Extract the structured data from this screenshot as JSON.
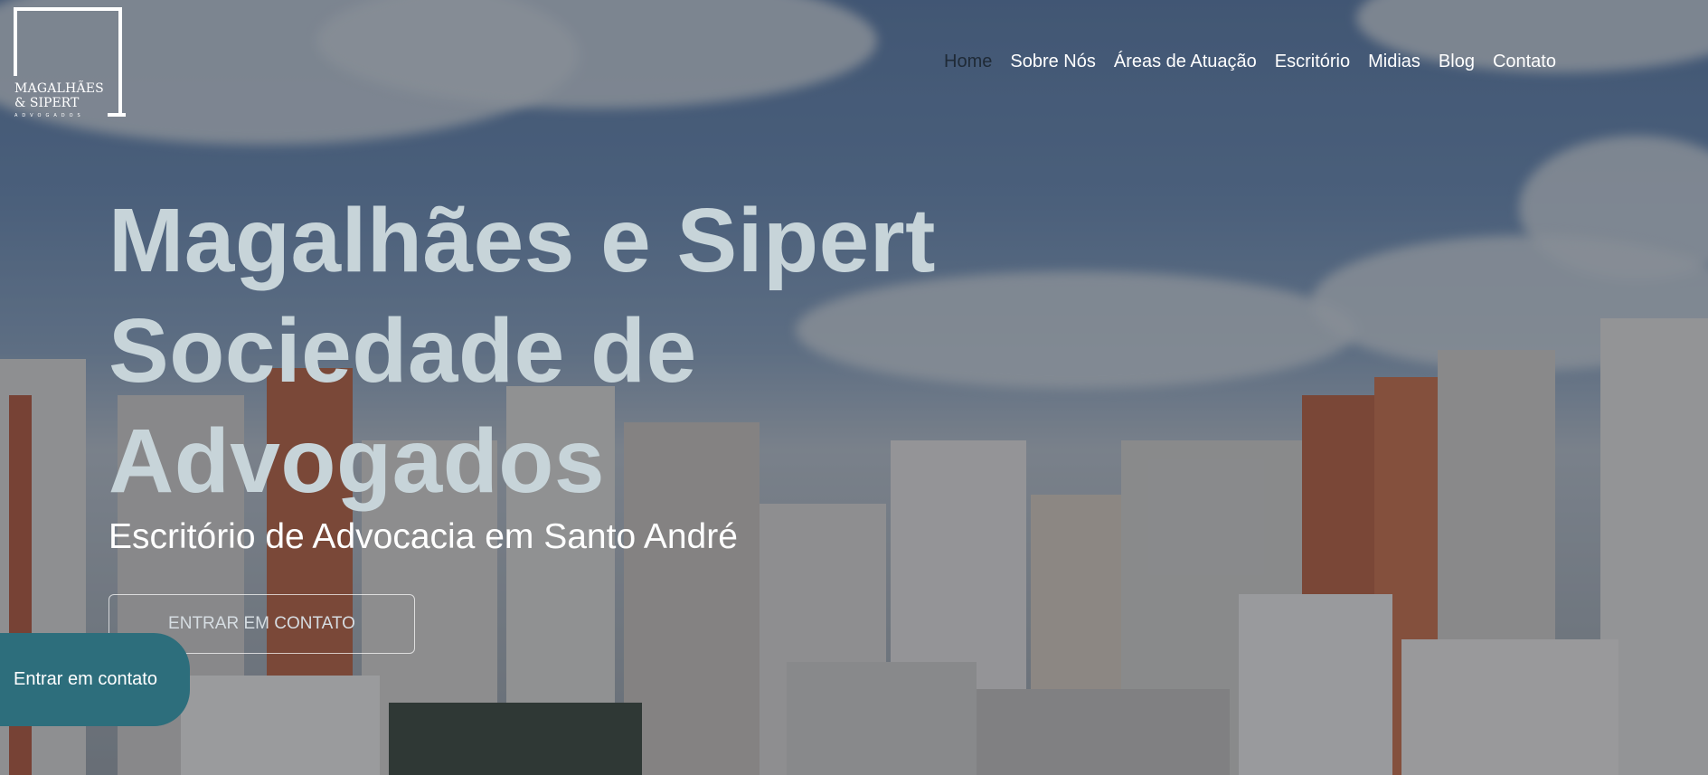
{
  "logo": {
    "line1": "MAGALHÃES",
    "line2": "& SIPERT",
    "line3": "ADVOGADOS"
  },
  "nav": {
    "items": [
      {
        "label": "Home"
      },
      {
        "label": "Sobre Nós"
      },
      {
        "label": "Áreas de Atuação"
      },
      {
        "label": "Escritório"
      },
      {
        "label": "Midias"
      },
      {
        "label": "Blog"
      },
      {
        "label": "Contato"
      }
    ],
    "active": "Home"
  },
  "hero": {
    "title_line1": "Magalhães e Sipert",
    "title_line2": "Sociedade de",
    "title_line3": "Advogados",
    "subtitle": "Escritório de Advocacia em Santo André",
    "cta_label": "ENTRAR EM CONTATO"
  },
  "floating_contact": {
    "label": "Entrar em contato",
    "color": "#2d6e7c"
  },
  "colors": {
    "title": "#c7d4d9",
    "nav_active": "#1f2a36"
  }
}
